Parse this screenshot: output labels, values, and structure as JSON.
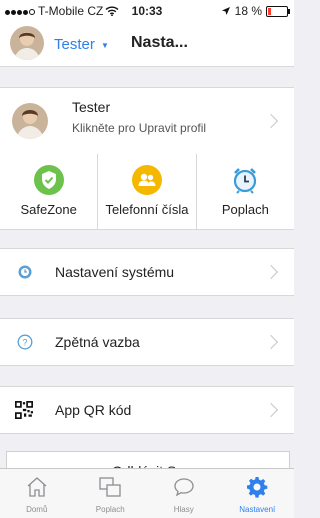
{
  "status_bar": {
    "carrier": "T-Mobile CZ",
    "time": "10:33",
    "battery": "18 %",
    "battery_level": 0.18
  },
  "navbar": {
    "user": "Tester",
    "title": "Nasta..."
  },
  "profile": {
    "name": "Tester",
    "subtitle": "Klikněte pro Upravit profil"
  },
  "quick_actions": [
    {
      "label": "SafeZone",
      "icon": "shield-check-icon",
      "color": "#6cc24a"
    },
    {
      "label": "Telefonní čísla",
      "icon": "contacts-icon",
      "color": "#f5b800"
    },
    {
      "label": "Poplach",
      "icon": "alarm-clock-icon",
      "color": "#3a9bd9"
    }
  ],
  "menu": {
    "system_settings": "Nastavení systému",
    "feedback": "Zpětná vazba",
    "qr_code": "App QR kód"
  },
  "logout_label": "Odhlásit Se",
  "tabbar": [
    {
      "label": "Domů",
      "icon": "home-icon",
      "active": false
    },
    {
      "label": "Poplach",
      "icon": "alarm-tab-icon",
      "active": false
    },
    {
      "label": "Hlasy",
      "icon": "chat-bubble-icon",
      "active": false
    },
    {
      "label": "Nastavení",
      "icon": "gear-icon",
      "active": true
    }
  ],
  "colors": {
    "accent": "#2f80ed",
    "background": "#efeff4"
  }
}
